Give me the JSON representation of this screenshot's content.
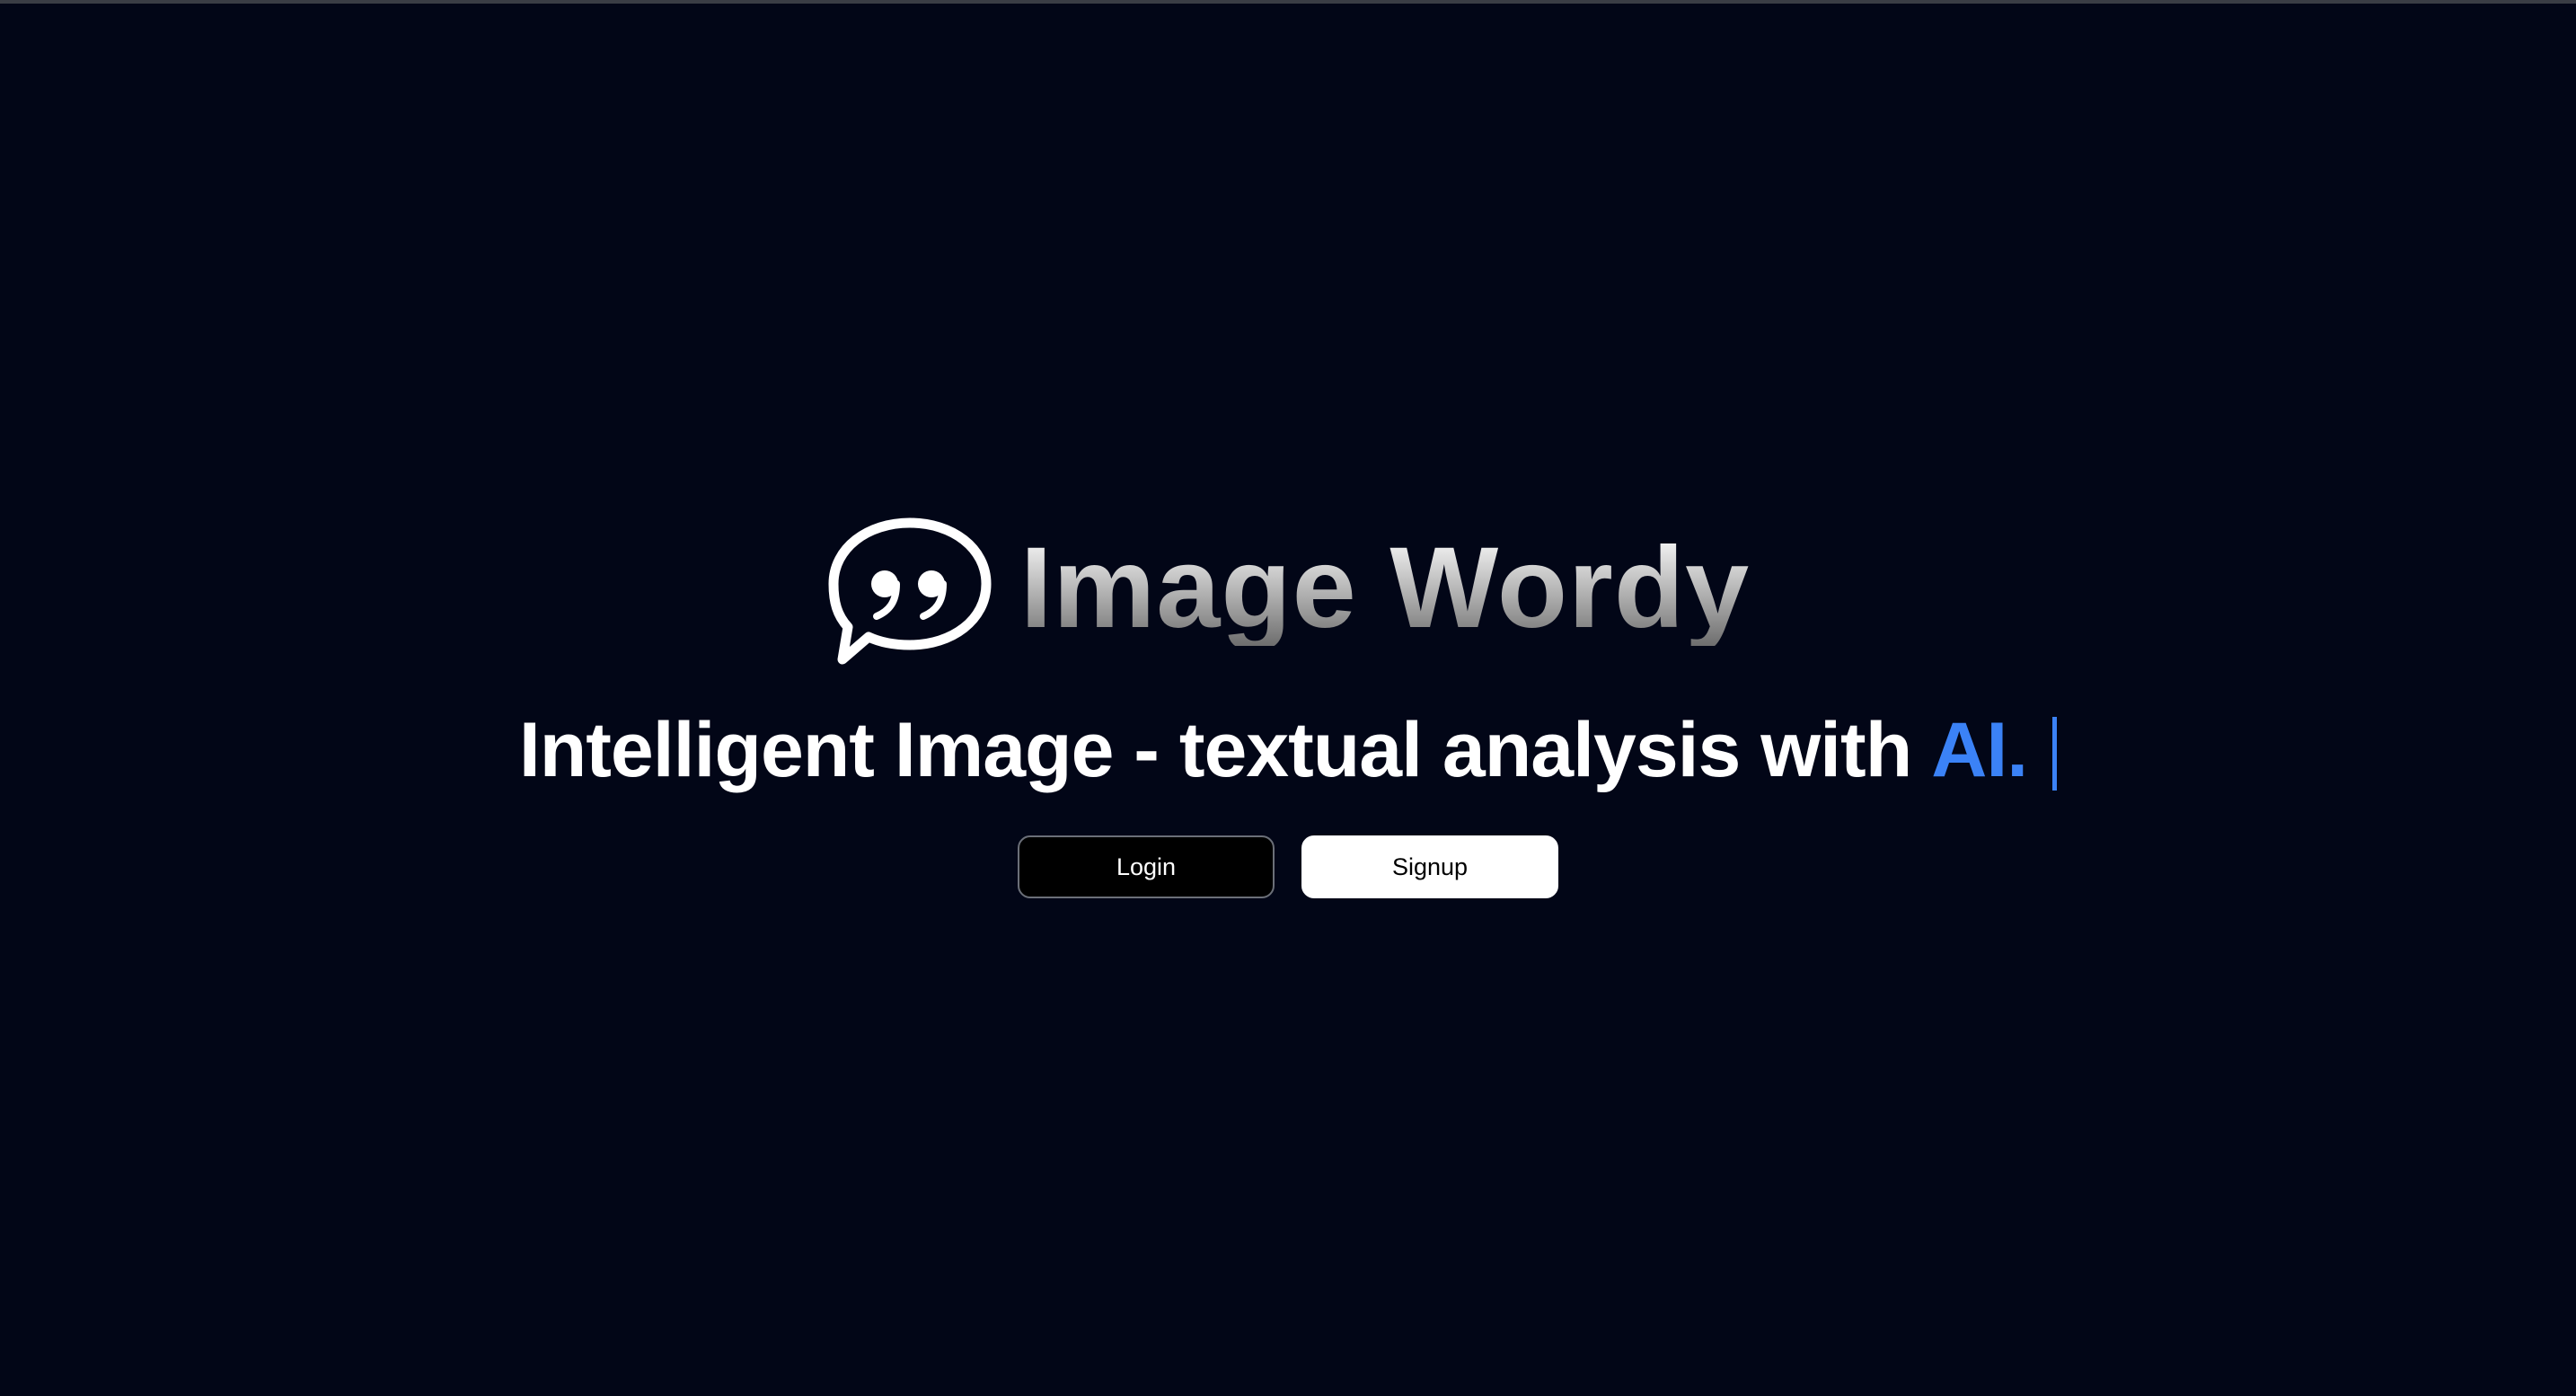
{
  "brand": {
    "name": "Image Wordy",
    "logo_icon": "quote-speech-bubble-icon"
  },
  "hero": {
    "tagline_main": "Intelligent Image - textual analysis with",
    "tagline_accent": "AI.",
    "accent_color": "#3b82f6"
  },
  "actions": {
    "login_label": "Login",
    "signup_label": "Signup"
  },
  "theme": {
    "background": "#020617"
  }
}
